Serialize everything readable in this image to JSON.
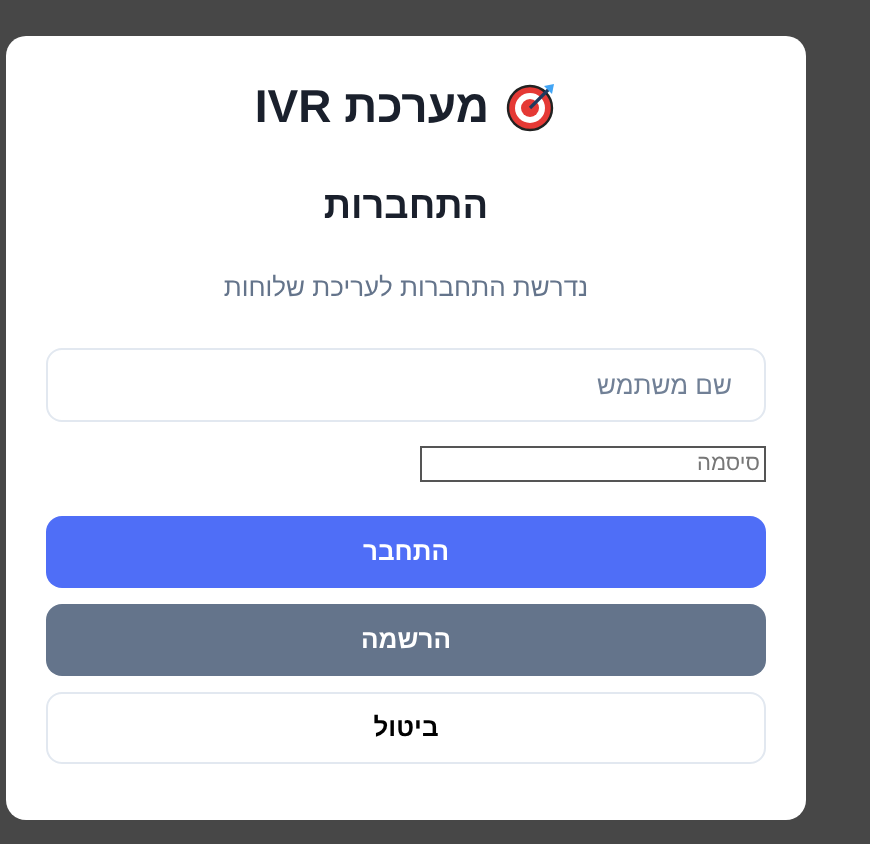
{
  "dialog": {
    "title": "מערכת IVR",
    "heading": "התחברות",
    "description": "נדרשת התחברות לעריכת שלוחות",
    "username": {
      "placeholder": "שם משתמש"
    },
    "password": {
      "placeholder": "סיסמה"
    },
    "buttons": [
      {
        "label": "התחבר",
        "kind": "primary"
      },
      {
        "label": "הרשמה",
        "kind": "secondary"
      },
      {
        "label": "ביטול",
        "kind": "outline"
      }
    ]
  }
}
